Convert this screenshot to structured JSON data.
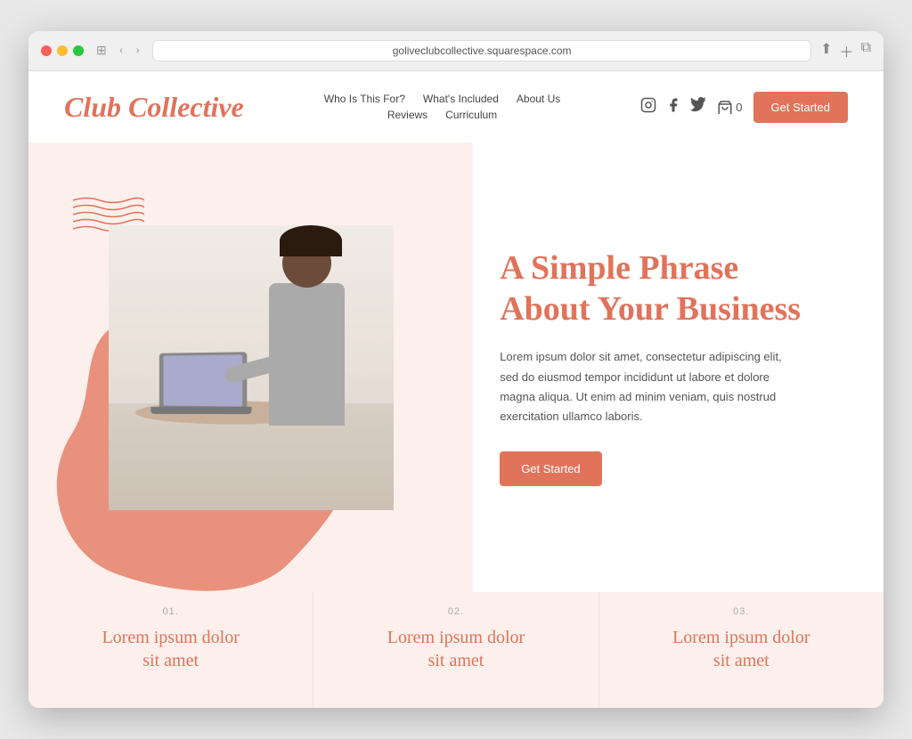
{
  "browser": {
    "url": "goliveclubcollective.squarespace.com"
  },
  "header": {
    "logo": "Club Collective",
    "nav": {
      "row1": [
        {
          "label": "Who Is This For?",
          "id": "who"
        },
        {
          "label": "What's Included",
          "id": "whats-included"
        },
        {
          "label": "About Us",
          "id": "about"
        }
      ],
      "row2": [
        {
          "label": "Reviews",
          "id": "reviews"
        },
        {
          "label": "Curriculum",
          "id": "curriculum"
        }
      ]
    },
    "cart_count": "0",
    "cta_button": "Get Started"
  },
  "hero": {
    "headline_line1": "A Simple Phrase",
    "headline_line2": "About Your Business",
    "body": "Lorem ipsum dolor sit amet, consectetur adipiscing elit, sed do eiusmod tempor incididunt ut labore et dolore magna aliqua. Ut enim ad minim veniam, quis nostrud exercitation ullamco laboris.",
    "cta_button": "Get Started"
  },
  "features": [
    {
      "number": "01.",
      "title_line1": "Lorem ipsum dolor",
      "title_line2": "sit amet"
    },
    {
      "number": "02.",
      "title_line1": "Lorem ipsum dolor",
      "title_line2": "sit amet"
    },
    {
      "number": "03.",
      "title_line1": "Lorem ipsum dolor",
      "title_line2": "sit amet"
    }
  ],
  "colors": {
    "accent": "#e0735a",
    "background_light": "#fdf0ec",
    "text_dark": "#444",
    "text_gray": "#777"
  }
}
